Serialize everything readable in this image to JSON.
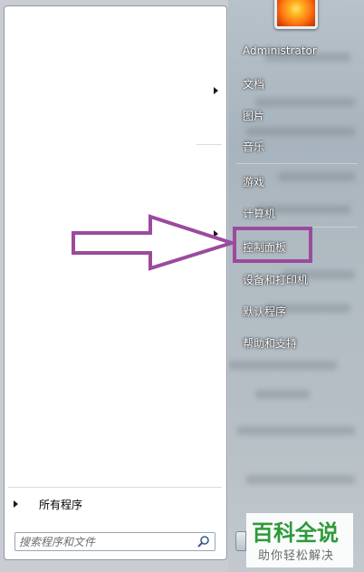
{
  "start_menu": {
    "user": {
      "name": "Administrator"
    },
    "right_items": [
      "文档",
      "图片",
      "音乐",
      "游戏",
      "计算机",
      "控制面板",
      "设备和打印机",
      "默认程序",
      "帮助和支持"
    ],
    "all_programs_label": "所有程序",
    "search": {
      "placeholder": "搜索程序和文件"
    }
  },
  "watermark": {
    "title": "百科全说",
    "subtitle": "助你轻松解决"
  },
  "colors": {
    "highlight": "#9b4a9e",
    "watermark_green": "#2e9a3a"
  }
}
